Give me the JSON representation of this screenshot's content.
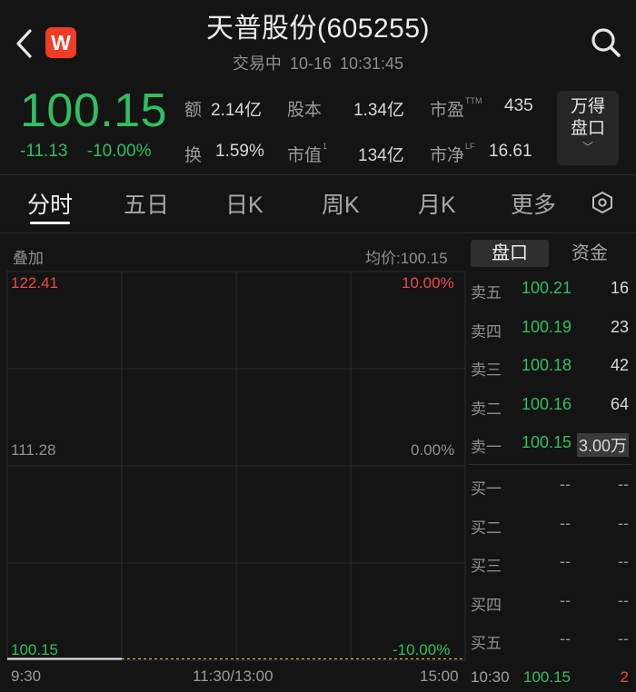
{
  "header": {
    "back_icon": "chevron-left-icon",
    "logo_text": "W",
    "logo_color": "#f03c24",
    "title": "天普股份(605255)",
    "status": "交易中",
    "date": "10-16",
    "time": "10:31:45",
    "search_icon": "search-icon"
  },
  "quote": {
    "price": "100.15",
    "change": "-11.13",
    "change_pct": "-10.00%",
    "price_color": "#2fbf5f",
    "stats": {
      "amount_label": "额",
      "amount": "2.14亿",
      "share_capital_label": "股本",
      "share_capital": "1.34亿",
      "pe_label": "市盈",
      "pe_sup": "TTM",
      "pe": "435",
      "turnover_label": "换",
      "turnover": "1.59%",
      "market_cap_label": "市值",
      "market_cap_sup": "1",
      "market_cap": "134亿",
      "pb_label": "市净",
      "pb_sup": "LF",
      "pb": "16.61"
    },
    "wan_button": {
      "line1": "万得",
      "line2": "盘口",
      "chevron": "﹀"
    }
  },
  "tabs": [
    {
      "label": "分时",
      "active": true
    },
    {
      "label": "五日",
      "active": false
    },
    {
      "label": "日K",
      "active": false
    },
    {
      "label": "周K",
      "active": false
    },
    {
      "label": "月K",
      "active": false
    },
    {
      "label": "更多",
      "active": false
    }
  ],
  "settings_icon": "hexagon-settings-icon",
  "chart": {
    "overlay_label": "叠加",
    "avg_price_label": "均价:100.15",
    "y_left": {
      "top": "122.41",
      "mid": "111.28",
      "bottom": "100.15"
    },
    "y_right": {
      "top": "10.00%",
      "mid": "0.00%",
      "bottom": "-10.00%"
    },
    "x_labels": {
      "start": "9:30",
      "mid": "11:30/13:00",
      "end": "15:00"
    }
  },
  "chart_data": {
    "type": "line",
    "x": [
      "9:30",
      "10:30"
    ],
    "values": [
      100.15,
      100.15
    ],
    "avg_price": 100.15,
    "prev_close": 111.28,
    "ylim": [
      100.15,
      122.41
    ],
    "ylim_pct": [
      "-10.00%",
      "10.00%"
    ],
    "x_ticks": [
      "9:30",
      "11:30/13:00",
      "15:00"
    ],
    "grid": true
  },
  "order_book": {
    "tabs": [
      {
        "label": "盘口",
        "active": true
      },
      {
        "label": "资金",
        "active": false
      }
    ],
    "asks": [
      {
        "name": "卖五",
        "price": "100.21",
        "vol": "16"
      },
      {
        "name": "卖四",
        "price": "100.19",
        "vol": "23"
      },
      {
        "name": "卖三",
        "price": "100.18",
        "vol": "42"
      },
      {
        "name": "卖二",
        "price": "100.16",
        "vol": "64"
      },
      {
        "name": "卖一",
        "price": "100.15",
        "vol": "3.00万"
      }
    ],
    "bids": [
      {
        "name": "买一",
        "price": "--",
        "vol": "--"
      },
      {
        "name": "买二",
        "price": "--",
        "vol": "--"
      },
      {
        "name": "买三",
        "price": "--",
        "vol": "--"
      },
      {
        "name": "买四",
        "price": "--",
        "vol": "--"
      },
      {
        "name": "买五",
        "price": "--",
        "vol": "--"
      }
    ],
    "last_tick": {
      "time": "10:30",
      "price": "100.15",
      "vol": "2"
    }
  }
}
